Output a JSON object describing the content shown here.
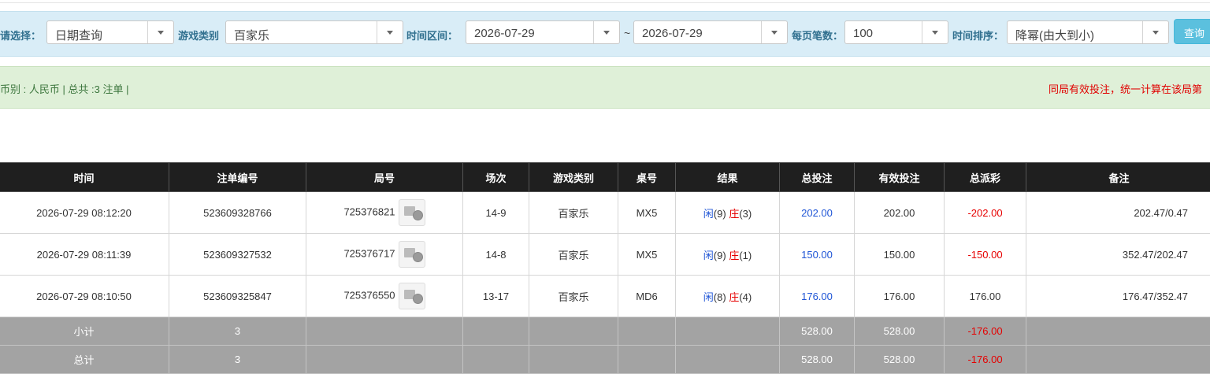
{
  "filter": {
    "select_label": "请选择：",
    "query_type": "日期查询",
    "game_type_label": "游戏类别",
    "game_type": "百家乐",
    "range_label": "时间区间：",
    "date_from": "2026-07-29",
    "range_sep": "~",
    "date_to": "2026-07-29",
    "per_page_label": "每页笔数：",
    "per_page": "100",
    "sort_label": "时间排序：",
    "sort": "降幂(由大到小)",
    "query_button": "查询"
  },
  "info": {
    "summary": "币别 : 人民币 | 总共 :3 注单 |",
    "notice": "同局有效投注，统一计算在该局第"
  },
  "table": {
    "headers": [
      "时间",
      "注单编号",
      "局号",
      "场次",
      "游戏类别",
      "桌号",
      "结果",
      "总投注",
      "有效投注",
      "总派彩",
      "备注"
    ],
    "rows": [
      {
        "time": "2026-07-29 08:12:20",
        "bet_no": "523609328766",
        "round_no": "725376821",
        "session": "14-9",
        "game": "百家乐",
        "table": "MX5",
        "r1": "闲",
        "r1n": "(9)",
        "r2": "庄",
        "r2n": "(3)",
        "total": "202.00",
        "valid": "202.00",
        "payout": "-202.00",
        "note": "202.47/0.47"
      },
      {
        "time": "2026-07-29 08:11:39",
        "bet_no": "523609327532",
        "round_no": "725376717",
        "session": "14-8",
        "game": "百家乐",
        "table": "MX5",
        "r1": "闲",
        "r1n": "(9)",
        "r2": "庄",
        "r2n": "(1)",
        "total": "150.00",
        "valid": "150.00",
        "payout": "-150.00",
        "note": "352.47/202.47"
      },
      {
        "time": "2026-07-29 08:10:50",
        "bet_no": "523609325847",
        "round_no": "725376550",
        "session": "13-17",
        "game": "百家乐",
        "table": "MD6",
        "r1": "闲",
        "r1n": "(8)",
        "r2": "庄",
        "r2n": "(4)",
        "total": "176.00",
        "valid": "176.00",
        "payout": "176.00",
        "note": "176.47/352.47"
      }
    ],
    "subtotal": {
      "label": "小计",
      "count": "3",
      "total": "528.00",
      "valid": "528.00",
      "payout": "-176.00"
    },
    "grand_total": {
      "label": "总计",
      "count": "3",
      "total": "528.00",
      "valid": "528.00",
      "payout": "-176.00"
    }
  },
  "colors": {
    "win_blue": "#1f55d6",
    "loss_red": "#e60000",
    "header_bg": "#1f1f1f",
    "sum_bg": "#a3a3a3"
  }
}
